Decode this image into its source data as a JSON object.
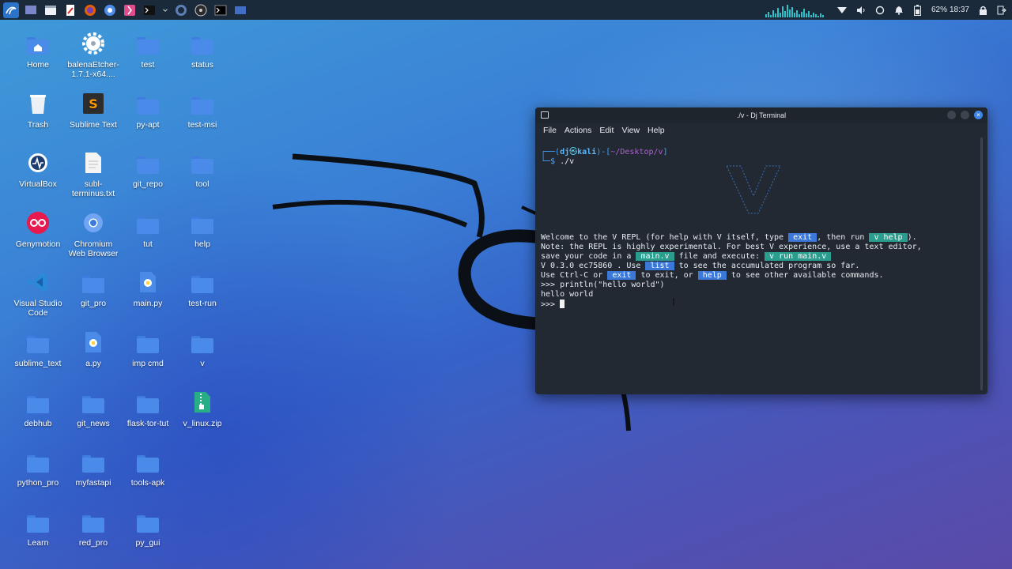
{
  "desktop": {
    "icons": [
      {
        "label": "Home",
        "type": "folder-home",
        "col": 0,
        "row": 0
      },
      {
        "label": "balenaEtcher-1.7.1-x64....",
        "type": "gear",
        "col": 1,
        "row": 0
      },
      {
        "label": "test",
        "type": "folder",
        "col": 2,
        "row": 0
      },
      {
        "label": "status",
        "type": "folder",
        "col": 3,
        "row": 0
      },
      {
        "label": "Trash",
        "type": "trash",
        "col": 0,
        "row": 1
      },
      {
        "label": "Sublime Text",
        "type": "sublime",
        "col": 1,
        "row": 1
      },
      {
        "label": "py-apt",
        "type": "folder",
        "col": 2,
        "row": 1
      },
      {
        "label": "test-msi",
        "type": "folder",
        "col": 3,
        "row": 1
      },
      {
        "label": "VirtualBox",
        "type": "virtualbox",
        "col": 0,
        "row": 2
      },
      {
        "label": "subl-terminus.txt",
        "type": "file",
        "col": 1,
        "row": 2
      },
      {
        "label": "git_repo",
        "type": "folder",
        "col": 2,
        "row": 2
      },
      {
        "label": "tool",
        "type": "folder",
        "col": 3,
        "row": 2
      },
      {
        "label": "Genymotion",
        "type": "genymotion",
        "col": 0,
        "row": 3
      },
      {
        "label": "Chromium Web Browser",
        "type": "chromium",
        "col": 1,
        "row": 3
      },
      {
        "label": "tut",
        "type": "folder",
        "col": 2,
        "row": 3
      },
      {
        "label": "help",
        "type": "folder",
        "col": 3,
        "row": 3
      },
      {
        "label": "Visual Studio Code",
        "type": "vscode",
        "col": 0,
        "row": 4
      },
      {
        "label": "git_pro",
        "type": "folder",
        "col": 1,
        "row": 4
      },
      {
        "label": "main.py",
        "type": "python",
        "col": 2,
        "row": 4
      },
      {
        "label": "test-run",
        "type": "folder",
        "col": 3,
        "row": 4
      },
      {
        "label": "sublime_text",
        "type": "folder",
        "col": 0,
        "row": 5
      },
      {
        "label": "a.py",
        "type": "python",
        "col": 1,
        "row": 5
      },
      {
        "label": "imp cmd",
        "type": "folder",
        "col": 2,
        "row": 5
      },
      {
        "label": "v",
        "type": "folder",
        "col": 3,
        "row": 5
      },
      {
        "label": "debhub",
        "type": "folder",
        "col": 0,
        "row": 6
      },
      {
        "label": "git_news",
        "type": "folder",
        "col": 1,
        "row": 6
      },
      {
        "label": "flask-tor-tut",
        "type": "folder",
        "col": 2,
        "row": 6
      },
      {
        "label": "v_linux.zip",
        "type": "zip",
        "col": 3,
        "row": 6
      },
      {
        "label": "python_pro",
        "type": "folder",
        "col": 0,
        "row": 7
      },
      {
        "label": "myfastapi",
        "type": "folder",
        "col": 1,
        "row": 7
      },
      {
        "label": "tools-apk",
        "type": "folder",
        "col": 2,
        "row": 7
      },
      {
        "label": "Learn",
        "type": "folder",
        "col": 0,
        "row": 8
      },
      {
        "label": "red_pro",
        "type": "folder",
        "col": 1,
        "row": 8
      },
      {
        "label": "py_gui",
        "type": "folder",
        "col": 2,
        "row": 8
      }
    ]
  },
  "panel": {
    "battery": "62%",
    "clock": "18:37"
  },
  "terminal": {
    "title": "./v - Dj Terminal",
    "menu": [
      "File",
      "Actions",
      "Edit",
      "View",
      "Help"
    ],
    "prompt": {
      "user": "dj",
      "at": "㉿",
      "host": "kali",
      "path": "~/Desktop/v",
      "command": "./v"
    },
    "lines": {
      "l1a": "Welcome to the V REPL (for help with V itself, type ",
      "l1b": " exit ",
      "l1c": ", then run ",
      "l1d": " v help ",
      "l1e": ").",
      "l2": "Note: the REPL is highly experimental. For best V experience, use a text editor,",
      "l3a": "save your code in a ",
      "l3b": " main.v ",
      "l3c": " file and execute: ",
      "l3d": " v run main.v ",
      "l4a": "V 0.3.0 ec75860 . Use ",
      "l4b": " list ",
      "l4c": " to see the accumulated program so far.",
      "l5a": "Use Ctrl-C or ",
      "l5b": " exit ",
      "l5c": " to exit, or ",
      "l5d": " help ",
      "l5e": " to see other available commands.",
      "l6": ">>> println(\"hello world\")",
      "l7": "hello world",
      "l8": ">>> "
    }
  }
}
